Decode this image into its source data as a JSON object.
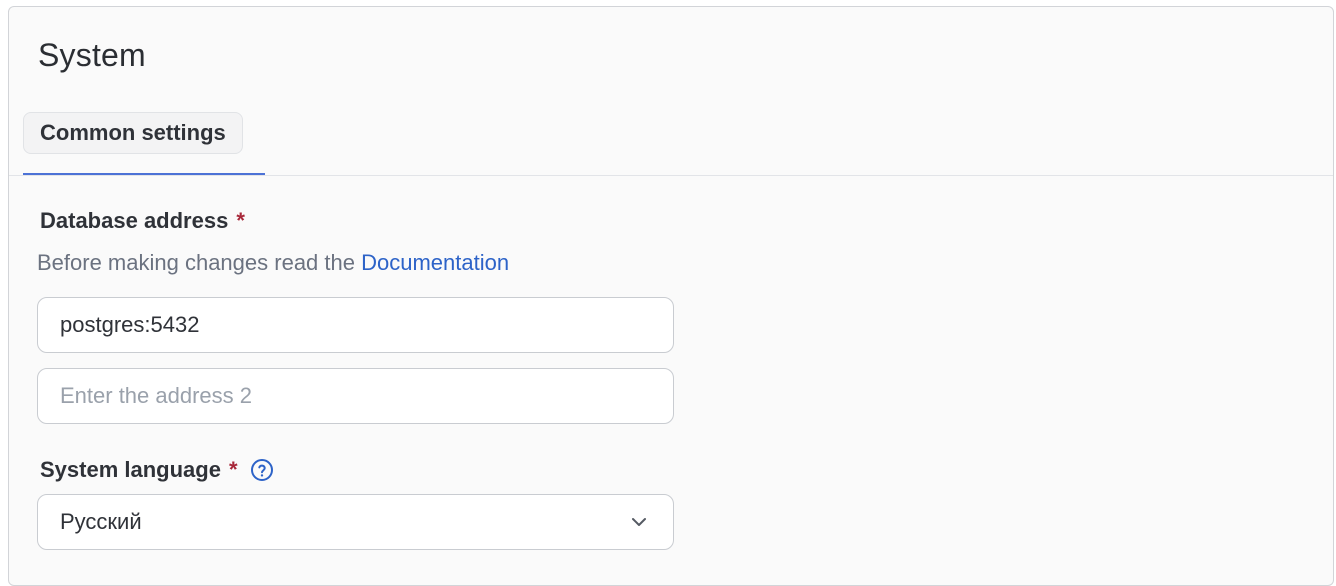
{
  "panel": {
    "title": "System"
  },
  "tabs": [
    {
      "label": "Common settings",
      "active": true
    }
  ],
  "database": {
    "label": "Database address",
    "required_mark": "*",
    "help_prefix": "Before making changes read the",
    "help_link": "Documentation",
    "address_1_value": "postgres:5432",
    "address_2_placeholder": "Enter the address 2"
  },
  "language": {
    "label": "System language",
    "required_mark": "*",
    "help_icon": "question-circle-icon",
    "selected": "Русский",
    "dropdown_icon": "chevron-down-icon"
  },
  "colors": {
    "accent": "#4c72d6",
    "link": "#2d63c8",
    "required": "#a8283a"
  }
}
